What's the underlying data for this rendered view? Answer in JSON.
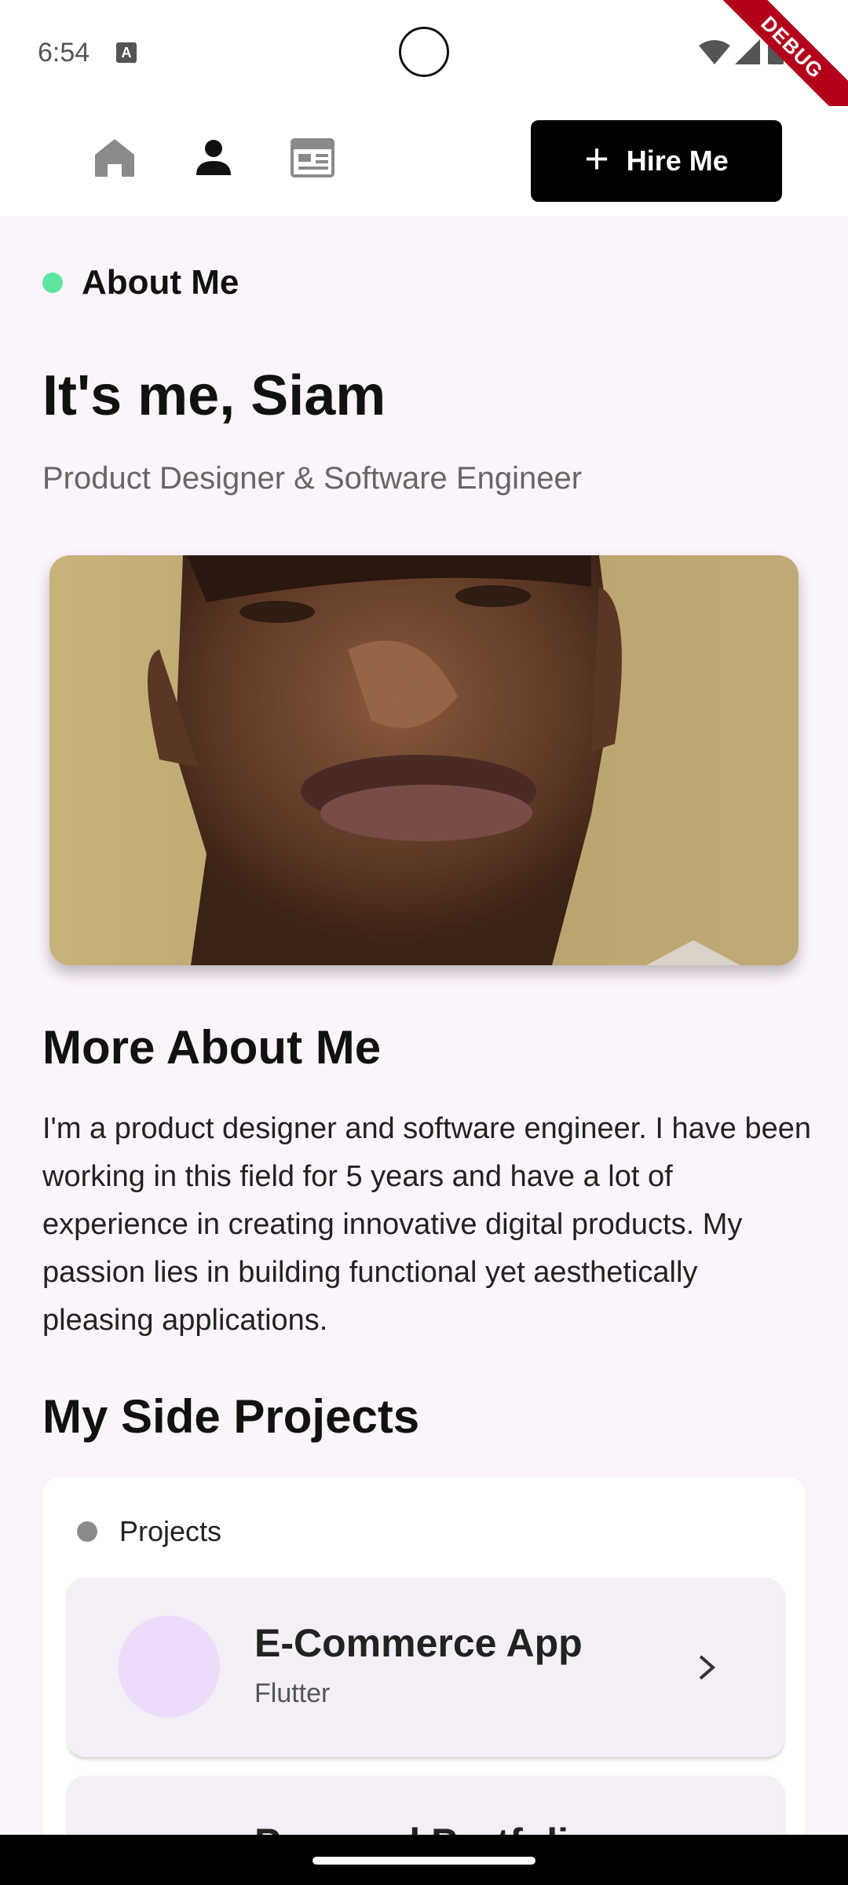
{
  "status_bar": {
    "time": "6:54",
    "keyboard_indicator": "A",
    "debug_label": "DEBUG"
  },
  "nav": {
    "icons": [
      "home-icon",
      "person-icon",
      "article-icon"
    ],
    "hire_button": {
      "icon": "plus-icon",
      "label": "Hire Me"
    }
  },
  "about": {
    "tag": "About Me",
    "headline": "It's me, Siam",
    "subtitle": "Product Designer & Software Engineer"
  },
  "more_about": {
    "title": "More About Me",
    "bio": "I'm a product designer and software engineer. I have been working in this field for 5 years and have a lot of experience in creating innovative digital products. My passion lies in building functional yet aesthetically pleasing applications."
  },
  "side_projects": {
    "title": "My Side Projects",
    "card_tag": "Projects",
    "items": [
      {
        "name": "E-Commerce App",
        "tech": "Flutter"
      },
      {
        "name": "Personal Portfolio",
        "tech": ""
      }
    ]
  },
  "colors": {
    "content_bg": "#fcf4fb",
    "accent_green": "#5ee6a0",
    "button_bg": "#000000",
    "project_item_bg": "#f4eff6",
    "project_avatar": "#ecdcfa",
    "debug_ribbon": "#b3001b"
  }
}
